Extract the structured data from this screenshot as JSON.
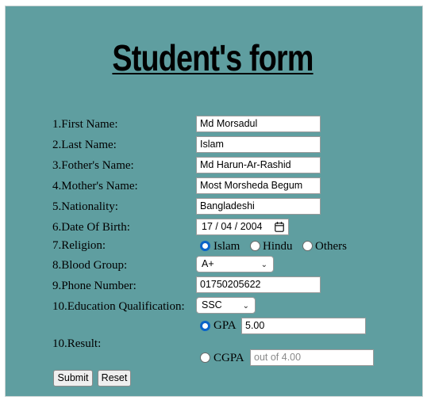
{
  "title": "Student's form",
  "fields": [
    {
      "label": "1.First Name:",
      "value": "Md Morsadul"
    },
    {
      "label": "2.Last Name:",
      "value": "Islam"
    },
    {
      "label": "3.Fother's Name:",
      "value": "Md Harun-Ar-Rashid"
    },
    {
      "label": "4.Mother's Name:",
      "value": "Most Morsheda Begum"
    },
    {
      "label": "5.Nationality:",
      "value": "Bangladeshi"
    }
  ],
  "dob": {
    "label": "6.Date Of Birth:",
    "day": "17",
    "month": "04",
    "year": "2004",
    "icon": "calendar-icon"
  },
  "religion": {
    "label": "7.Religion:",
    "options": [
      "Islam",
      "Hindu",
      "Others"
    ],
    "selected": "Islam"
  },
  "blood_group": {
    "label": "8.Blood Group:",
    "value": "A+"
  },
  "phone": {
    "label": "9.Phone Number:",
    "value": "01750205622"
  },
  "education": {
    "label": "10.Education Qualification:",
    "value": "SSC"
  },
  "result": {
    "label": "10.Result:",
    "gpa": {
      "label": "GPA",
      "value": "5.00",
      "selected": true
    },
    "cgpa": {
      "label": "CGPA",
      "placeholder": "out of 4.00",
      "selected": false
    }
  },
  "buttons": {
    "submit": "Submit",
    "reset": "Reset"
  },
  "colors": {
    "panel": "#5f9ea0",
    "radio_accent": "#0a64c8"
  }
}
